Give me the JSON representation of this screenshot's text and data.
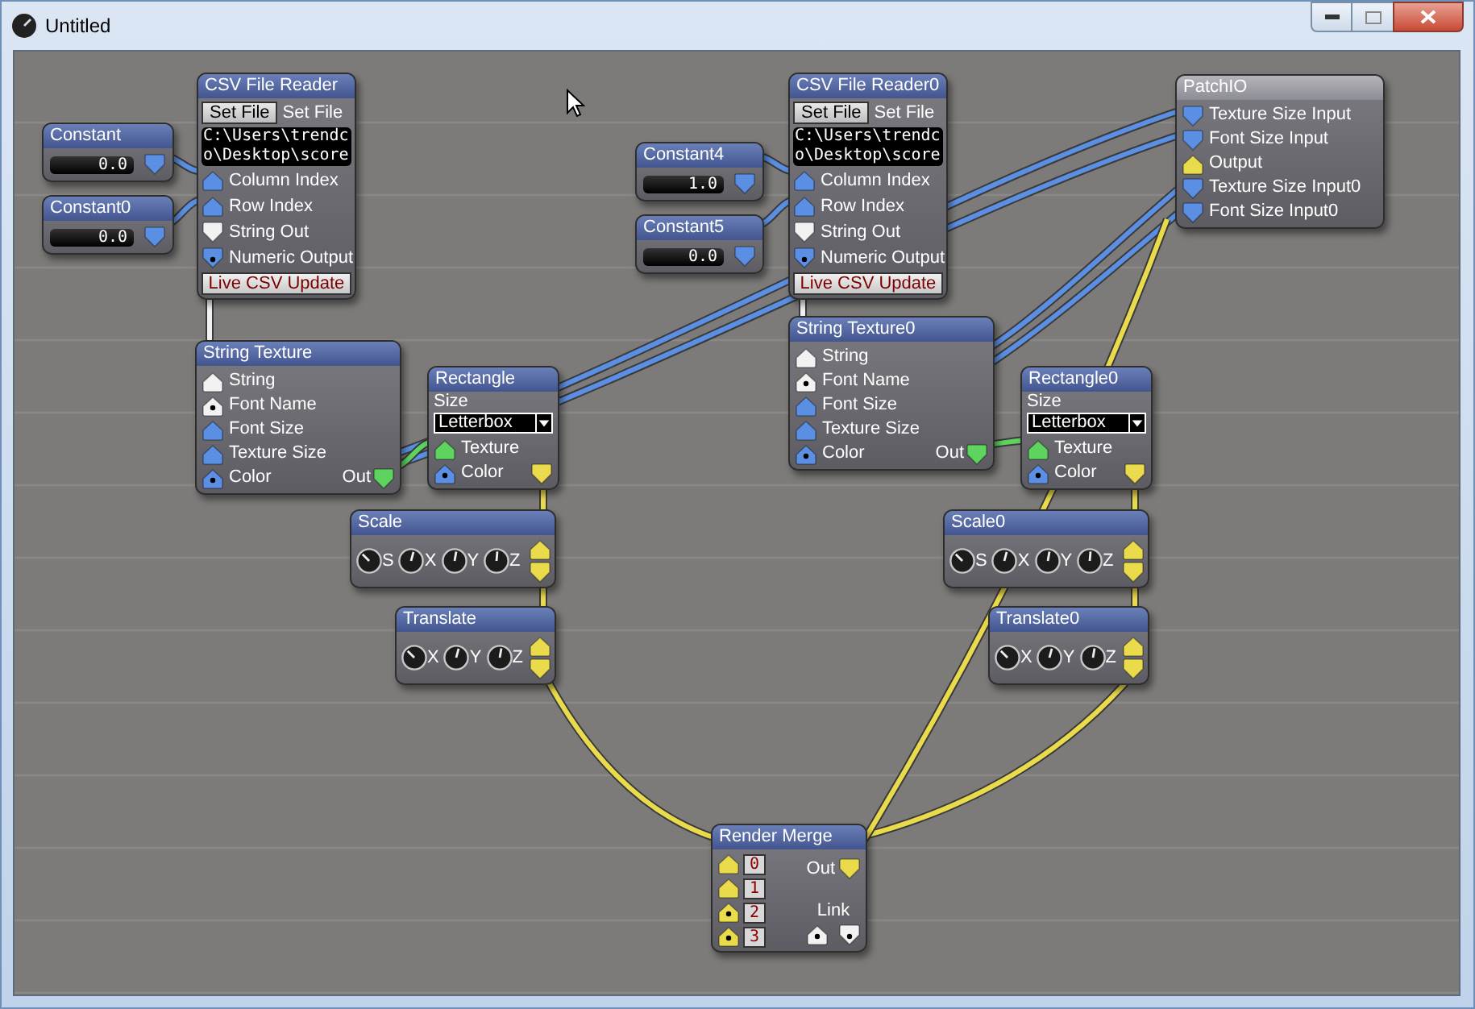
{
  "window": {
    "title": "Untitled"
  },
  "nodes": [
    {
      "kind": "constant",
      "title": "Constant",
      "value": "0.0",
      "output": {
        "color": "#5b8fe3",
        "out": true,
        "dot": false
      }
    },
    {
      "kind": "constant",
      "title": "Constant0",
      "value": "0.0",
      "output": {
        "color": "#5b8fe3",
        "out": true,
        "dot": false
      }
    },
    {
      "kind": "csv",
      "title": "CSV File Reader",
      "button": "Set File",
      "button_label": "Set File",
      "path": [
        "C:\\Users\\trendc",
        "o\\Desktop\\score"
      ],
      "ports": [
        {
          "label": "Column Index",
          "color": "#5b8fe3",
          "out": false,
          "dot": false
        },
        {
          "label": "Row Index",
          "color": "#5b8fe3",
          "out": false,
          "dot": false
        },
        {
          "label": "String Out",
          "color": "#f2f2f2",
          "out": true,
          "dot": false
        },
        {
          "label": "Numeric Output",
          "color": "#5b8fe3",
          "out": true,
          "dot": true
        }
      ],
      "live_button": "Live CSV Update"
    },
    {
      "kind": "ports",
      "title": "String Texture",
      "ports": [
        {
          "label": "String",
          "color": "#f2f2f2",
          "out": false,
          "dot": false
        },
        {
          "label": "Font Name",
          "color": "#f2f2f2",
          "out": false,
          "dot": true
        },
        {
          "label": "Font Size",
          "color": "#5b8fe3",
          "out": false,
          "dot": false
        },
        {
          "label": "Texture Size",
          "color": "#5b8fe3",
          "out": false,
          "dot": false
        },
        {
          "label": "Color",
          "color": "#5b8fe3",
          "out": false,
          "dot": true
        }
      ],
      "output": {
        "label": "Out",
        "color": "#5fd35f",
        "out": true,
        "dot": false
      }
    },
    {
      "kind": "rectangle",
      "title": "Rectangle",
      "size_label": "Size",
      "dropdown": "Letterbox",
      "ports": [
        {
          "label": "Texture",
          "color": "#5fd35f",
          "out": false,
          "dot": false
        },
        {
          "label": "Color",
          "color": "#5b8fe3",
          "out": false,
          "dot": true
        }
      ],
      "output": {
        "color": "#eadb4c",
        "out": true,
        "dot": false
      }
    },
    {
      "kind": "transform",
      "title": "Scale",
      "knobs": [
        "S",
        "X",
        "Y",
        "Z"
      ]
    },
    {
      "kind": "transform",
      "title": "Translate",
      "knobs": [
        "X",
        "Y",
        "Z"
      ]
    },
    {
      "kind": "constant",
      "title": "Constant4",
      "value": "1.0",
      "output": {
        "color": "#5b8fe3",
        "out": true,
        "dot": false
      }
    },
    {
      "kind": "constant",
      "title": "Constant5",
      "value": "0.0",
      "output": {
        "color": "#5b8fe3",
        "out": true,
        "dot": false
      }
    },
    {
      "kind": "csv",
      "title": "CSV File Reader0",
      "button": "Set File",
      "button_label": "Set File",
      "path": [
        "C:\\Users\\trendc",
        "o\\Desktop\\score"
      ],
      "ports": [
        {
          "label": "Column Index",
          "color": "#5b8fe3",
          "out": false,
          "dot": false
        },
        {
          "label": "Row Index",
          "color": "#5b8fe3",
          "out": false,
          "dot": false
        },
        {
          "label": "String Out",
          "color": "#f2f2f2",
          "out": true,
          "dot": false
        },
        {
          "label": "Numeric Output",
          "color": "#5b8fe3",
          "out": true,
          "dot": true
        }
      ],
      "live_button": "Live CSV Update"
    },
    {
      "kind": "ports",
      "title": "String Texture0",
      "ports": [
        {
          "label": "String",
          "color": "#f2f2f2",
          "out": false,
          "dot": false
        },
        {
          "label": "Font Name",
          "color": "#f2f2f2",
          "out": false,
          "dot": true
        },
        {
          "label": "Font Size",
          "color": "#5b8fe3",
          "out": false,
          "dot": false
        },
        {
          "label": "Texture Size",
          "color": "#5b8fe3",
          "out": false,
          "dot": false
        },
        {
          "label": "Color",
          "color": "#5b8fe3",
          "out": false,
          "dot": true
        }
      ],
      "output": {
        "label": "Out",
        "color": "#5fd35f",
        "out": true,
        "dot": false
      }
    },
    {
      "kind": "rectangle",
      "title": "Rectangle0",
      "size_label": "Size",
      "dropdown": "Letterbox",
      "ports": [
        {
          "label": "Texture",
          "color": "#5fd35f",
          "out": false,
          "dot": false
        },
        {
          "label": "Color",
          "color": "#5b8fe3",
          "out": false,
          "dot": true
        }
      ],
      "output": {
        "color": "#eadb4c",
        "out": true,
        "dot": false
      }
    },
    {
      "kind": "transform",
      "title": "Scale0",
      "knobs": [
        "S",
        "X",
        "Y",
        "Z"
      ]
    },
    {
      "kind": "transform",
      "title": "Translate0",
      "knobs": [
        "X",
        "Y",
        "Z"
      ]
    },
    {
      "kind": "patchio",
      "title": "PatchIO",
      "ports": [
        {
          "label": "Texture Size Input",
          "color": "#5b8fe3",
          "out": true,
          "dot": false
        },
        {
          "label": "Font Size Input",
          "color": "#5b8fe3",
          "out": true,
          "dot": false
        },
        {
          "label": "Output",
          "color": "#eadb4c",
          "out": false,
          "dot": false
        },
        {
          "label": "Texture Size Input0",
          "color": "#5b8fe3",
          "out": true,
          "dot": false
        },
        {
          "label": "Font Size Input0",
          "color": "#5b8fe3",
          "out": true,
          "dot": false
        }
      ]
    },
    {
      "kind": "merge",
      "title": "Render Merge",
      "inputs": [
        {
          "label": "0",
          "dot": false
        },
        {
          "label": "1",
          "dot": false
        },
        {
          "label": "2",
          "dot": true
        },
        {
          "label": "3",
          "dot": true
        }
      ],
      "output": {
        "label": "Out",
        "color": "#eadb4c",
        "out": true,
        "dot": false
      },
      "link": {
        "label": "Link",
        "ports": [
          {
            "color": "#f2f2f2",
            "out": false,
            "dot": true
          },
          {
            "color": "#f2f2f2",
            "out": true,
            "dot": true
          }
        ]
      }
    }
  ]
}
